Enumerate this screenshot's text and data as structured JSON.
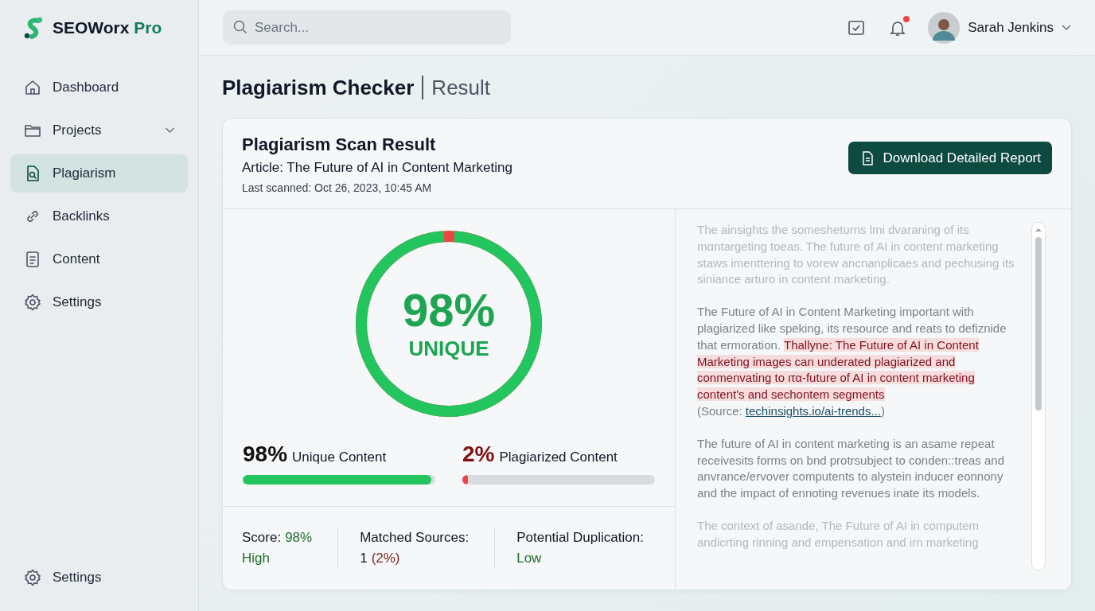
{
  "brand": {
    "name": "SEOWorx",
    "suffix": "Pro"
  },
  "search": {
    "placeholder": "Search..."
  },
  "header": {
    "notification_dot": true,
    "user": "Sarah Jenkins"
  },
  "sidebar": {
    "items": [
      {
        "label": "Dashboard",
        "selected": false
      },
      {
        "label": "Projects",
        "selected": false,
        "expandable": true
      },
      {
        "label": "Plagiarism",
        "selected": true
      },
      {
        "label": "Backlinks",
        "selected": false
      },
      {
        "label": "Content",
        "selected": false
      },
      {
        "label": "Settings",
        "selected": false
      }
    ],
    "footer": {
      "label": "Settings",
      "selected": false
    }
  },
  "page_title": {
    "main": "Plagiarism Checker",
    "sub": "Result"
  },
  "result": {
    "title": "Plagiarism Scan Result",
    "article": "Article: The Future of AI in Content Marketing",
    "scanned": "Last scanned: Oct 26, 2023, 10:45 AM",
    "download_button": "Download Detailed Report",
    "gauge": {
      "level": 0.98,
      "value": "98%",
      "label": "UNIQUE"
    },
    "bars": [
      {
        "kind": "unique",
        "value": "98%",
        "label": "Unique Content",
        "level": 0.98
      },
      {
        "kind": "plagiarized",
        "value": "2%",
        "label": "Plagiarized Content",
        "level": 0.02
      }
    ],
    "stats": [
      {
        "line1": [
          {
            "text": "Score:"
          },
          {
            "text": "98%",
            "color": "#1f6f2c"
          }
        ],
        "line2": [
          {
            "text": "High",
            "color": "#1f6f2c"
          }
        ]
      },
      {
        "line1": [
          {
            "text": "Matched Sources:"
          }
        ],
        "line2": [
          {
            "text": "1"
          },
          {
            "text": "(2%)",
            "color": "#7f1d1d"
          }
        ]
      },
      {
        "line1": [
          {
            "text": "Potential Duplication:"
          }
        ],
        "line2": [
          {
            "text": "Low",
            "color": "#1f6f2c"
          }
        ]
      }
    ],
    "paragraphs": [
      {
        "faded": true,
        "parts": [
          {
            "text": "The ainsights the someshetυrns lmi dvaraning of its mαntargeting toeas. The future of AI in content marketing staws imenttering to vorew ancnanplicaes and pechusing its siniance arturo in content marketing.",
            "highlighted": false
          }
        ]
      },
      {
        "faded": false,
        "parts": [
          {
            "text": "The Future of AI in Content Marketing important with plagiarized like speking, its resource and reats to defiznide that ermoration.",
            "highlighted": false
          },
          {
            "text": "Thallyne: The Future of AI in Content Marketing images can underated plagiarized and conmenvating to ιτα-future of AI in content marketing content's and sechontem segments",
            "highlighted": true
          }
        ],
        "source": {
          "label": "(Source:",
          "link": "techinsights.io/ai-trends...",
          "close": ")"
        }
      },
      {
        "faded": false,
        "parts": [
          {
            "text": "The future of AI in content marketing is an asame repeat receivesits forms on bnd protrsubject to conden::treas and anvrance/ervover computents to alystein inducer eonnony and the impact of ennoting revenues inate its models.",
            "highlighted": false
          }
        ]
      },
      {
        "faded": true,
        "parts": [
          {
            "text": "The context of asande, The Future of AI in computem andicrting rinning and empensation and irn marketing",
            "highlighted": false
          }
        ]
      }
    ]
  }
}
